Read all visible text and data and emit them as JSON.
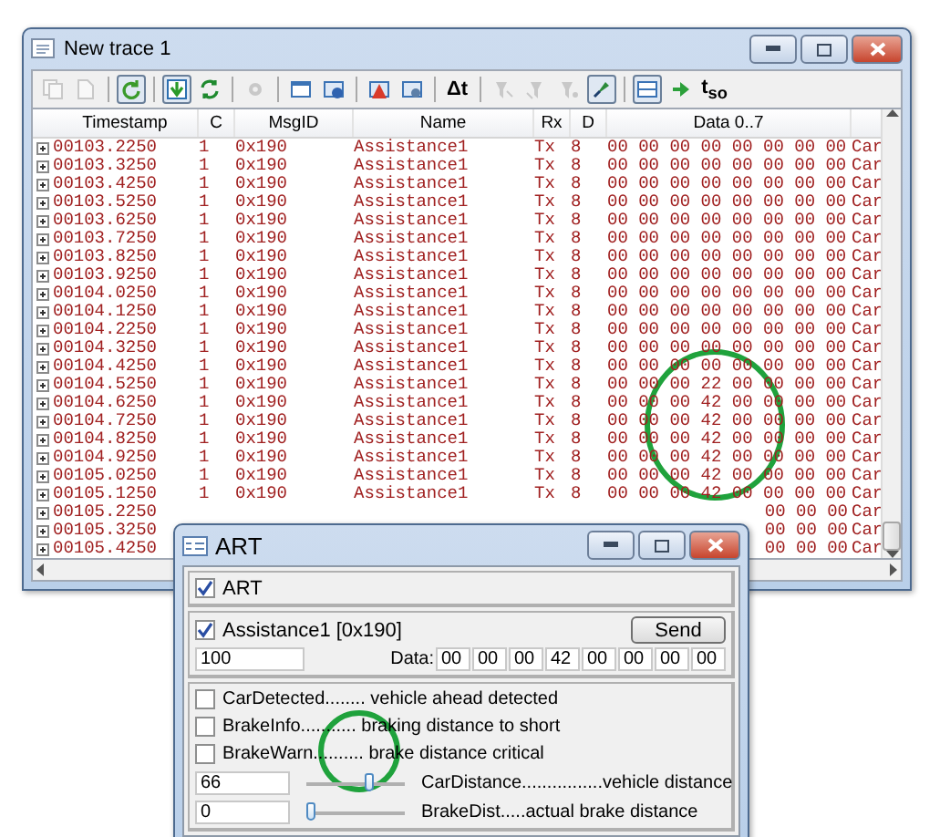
{
  "trace_window": {
    "title": "New trace 1",
    "toolbar": [
      {
        "kind": "button",
        "pressed": false,
        "disabled": true
      },
      {
        "kind": "button",
        "pressed": false,
        "disabled": true
      },
      {
        "kind": "separator"
      },
      {
        "kind": "button",
        "pressed": true,
        "disabled": false
      },
      {
        "kind": "separator"
      },
      {
        "kind": "button",
        "pressed": true,
        "disabled": false
      },
      {
        "kind": "button",
        "pressed": false,
        "disabled": false
      },
      {
        "kind": "separator"
      },
      {
        "kind": "button",
        "pressed": false,
        "disabled": true
      },
      {
        "kind": "separator"
      },
      {
        "kind": "button",
        "pressed": false,
        "disabled": false
      },
      {
        "kind": "button",
        "pressed": false,
        "disabled": false
      },
      {
        "kind": "separator"
      },
      {
        "kind": "button",
        "pressed": false,
        "disabled": false
      },
      {
        "kind": "button",
        "pressed": false,
        "disabled": false
      },
      {
        "kind": "separator"
      },
      {
        "kind": "text",
        "label": "Δt"
      },
      {
        "kind": "separator"
      },
      {
        "kind": "button",
        "pressed": false,
        "disabled": true
      },
      {
        "kind": "button",
        "pressed": false,
        "disabled": true
      },
      {
        "kind": "button",
        "pressed": false,
        "disabled": true
      },
      {
        "kind": "button",
        "pressed": true,
        "disabled": false
      },
      {
        "kind": "separator"
      },
      {
        "kind": "button",
        "pressed": true,
        "disabled": false
      },
      {
        "kind": "button",
        "pressed": false,
        "disabled": false
      },
      {
        "kind": "text",
        "label": "t$_{so}$"
      }
    ],
    "columns": [
      "Timestamp",
      "C",
      "MsgID",
      "Name",
      "Rx",
      "D",
      "Data 0..7"
    ],
    "rows": [
      {
        "timestamp": "00103.2250",
        "channel": "1",
        "msg_id": "0x190",
        "name": "Assistance1",
        "dir": "Tx",
        "dlc": "8",
        "data": "00 00 00 00 00 00 00 00",
        "comment": "Car"
      },
      {
        "timestamp": "00103.3250",
        "channel": "1",
        "msg_id": "0x190",
        "name": "Assistance1",
        "dir": "Tx",
        "dlc": "8",
        "data": "00 00 00 00 00 00 00 00",
        "comment": "Car"
      },
      {
        "timestamp": "00103.4250",
        "channel": "1",
        "msg_id": "0x190",
        "name": "Assistance1",
        "dir": "Tx",
        "dlc": "8",
        "data": "00 00 00 00 00 00 00 00",
        "comment": "Car"
      },
      {
        "timestamp": "00103.5250",
        "channel": "1",
        "msg_id": "0x190",
        "name": "Assistance1",
        "dir": "Tx",
        "dlc": "8",
        "data": "00 00 00 00 00 00 00 00",
        "comment": "Car"
      },
      {
        "timestamp": "00103.6250",
        "channel": "1",
        "msg_id": "0x190",
        "name": "Assistance1",
        "dir": "Tx",
        "dlc": "8",
        "data": "00 00 00 00 00 00 00 00",
        "comment": "Car"
      },
      {
        "timestamp": "00103.7250",
        "channel": "1",
        "msg_id": "0x190",
        "name": "Assistance1",
        "dir": "Tx",
        "dlc": "8",
        "data": "00 00 00 00 00 00 00 00",
        "comment": "Car"
      },
      {
        "timestamp": "00103.8250",
        "channel": "1",
        "msg_id": "0x190",
        "name": "Assistance1",
        "dir": "Tx",
        "dlc": "8",
        "data": "00 00 00 00 00 00 00 00",
        "comment": "Car"
      },
      {
        "timestamp": "00103.9250",
        "channel": "1",
        "msg_id": "0x190",
        "name": "Assistance1",
        "dir": "Tx",
        "dlc": "8",
        "data": "00 00 00 00 00 00 00 00",
        "comment": "Car"
      },
      {
        "timestamp": "00104.0250",
        "channel": "1",
        "msg_id": "0x190",
        "name": "Assistance1",
        "dir": "Tx",
        "dlc": "8",
        "data": "00 00 00 00 00 00 00 00",
        "comment": "Car"
      },
      {
        "timestamp": "00104.1250",
        "channel": "1",
        "msg_id": "0x190",
        "name": "Assistance1",
        "dir": "Tx",
        "dlc": "8",
        "data": "00 00 00 00 00 00 00 00",
        "comment": "Car"
      },
      {
        "timestamp": "00104.2250",
        "channel": "1",
        "msg_id": "0x190",
        "name": "Assistance1",
        "dir": "Tx",
        "dlc": "8",
        "data": "00 00 00 00 00 00 00 00",
        "comment": "Car"
      },
      {
        "timestamp": "00104.3250",
        "channel": "1",
        "msg_id": "0x190",
        "name": "Assistance1",
        "dir": "Tx",
        "dlc": "8",
        "data": "00 00 00 00 00 00 00 00",
        "comment": "Car"
      },
      {
        "timestamp": "00104.4250",
        "channel": "1",
        "msg_id": "0x190",
        "name": "Assistance1",
        "dir": "Tx",
        "dlc": "8",
        "data": "00 00 00 00 00 00 00 00",
        "comment": "Car"
      },
      {
        "timestamp": "00104.5250",
        "channel": "1",
        "msg_id": "0x190",
        "name": "Assistance1",
        "dir": "Tx",
        "dlc": "8",
        "data": "00 00 00 22 00 00 00 00",
        "comment": "Car"
      },
      {
        "timestamp": "00104.6250",
        "channel": "1",
        "msg_id": "0x190",
        "name": "Assistance1",
        "dir": "Tx",
        "dlc": "8",
        "data": "00 00 00 42 00 00 00 00",
        "comment": "Car"
      },
      {
        "timestamp": "00104.7250",
        "channel": "1",
        "msg_id": "0x190",
        "name": "Assistance1",
        "dir": "Tx",
        "dlc": "8",
        "data": "00 00 00 42 00 00 00 00",
        "comment": "Car"
      },
      {
        "timestamp": "00104.8250",
        "channel": "1",
        "msg_id": "0x190",
        "name": "Assistance1",
        "dir": "Tx",
        "dlc": "8",
        "data": "00 00 00 42 00 00 00 00",
        "comment": "Car"
      },
      {
        "timestamp": "00104.9250",
        "channel": "1",
        "msg_id": "0x190",
        "name": "Assistance1",
        "dir": "Tx",
        "dlc": "8",
        "data": "00 00 00 42 00 00 00 00",
        "comment": "Car"
      },
      {
        "timestamp": "00105.0250",
        "channel": "1",
        "msg_id": "0x190",
        "name": "Assistance1",
        "dir": "Tx",
        "dlc": "8",
        "data": "00 00 00 42 00 00 00 00",
        "comment": "Car"
      },
      {
        "timestamp": "00105.1250",
        "channel": "1",
        "msg_id": "0x190",
        "name": "Assistance1",
        "dir": "Tx",
        "dlc": "8",
        "data": "00 00 00 42 00 00 00 00",
        "comment": "Car"
      },
      {
        "timestamp": "00105.2250",
        "data": "00 00 00",
        "comment": "Car"
      },
      {
        "timestamp": "00105.3250",
        "data": "00 00 00",
        "comment": "Car"
      },
      {
        "timestamp": "00105.4250",
        "data": "00 00 00",
        "comment": "Car"
      }
    ]
  },
  "art_dialog": {
    "title": "ART",
    "node": {
      "label": "ART",
      "checked": true
    },
    "message": {
      "label": "Assistance1 [0x190]",
      "checked": true,
      "send": "Send",
      "cycle": "100",
      "data_label": "Data:",
      "bytes": [
        "00",
        "00",
        "00",
        "42",
        "00",
        "00",
        "00",
        "00"
      ]
    },
    "signals": [
      {
        "kind": "checkbox",
        "label": "CarDetected........ vehicle ahead detected",
        "checked": false
      },
      {
        "kind": "checkbox",
        "label": "BrakeInfo........... braking distance to short",
        "checked": false
      },
      {
        "kind": "checkbox",
        "label": "BrakeWarn.......... brake distance critical",
        "checked": false
      },
      {
        "kind": "slider",
        "entry": "66",
        "level": 0.66,
        "label": "CarDistance................vehicle distance"
      },
      {
        "kind": "slider",
        "entry": "0",
        "level": 0,
        "label": "BrakeDist.....actual brake distance"
      }
    ]
  }
}
